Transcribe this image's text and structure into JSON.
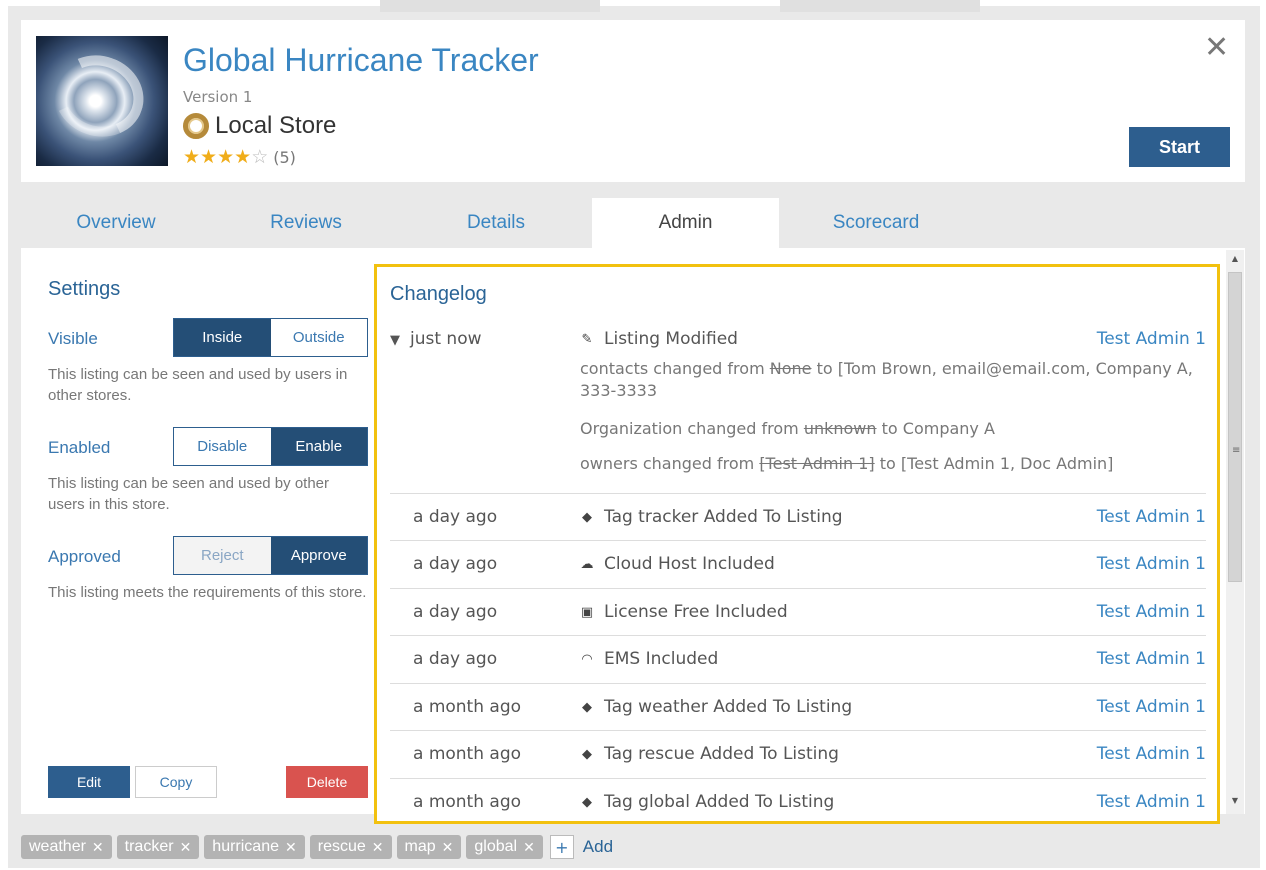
{
  "listing": {
    "title": "Global Hurricane Tracker",
    "version": "Version 1",
    "store": "Local Store",
    "rating_stars_filled": 4,
    "rating_stars_total": 5,
    "rating_count": "(5)",
    "close_glyph": "✕",
    "start_label": "Start"
  },
  "tabs": [
    {
      "label": "Overview",
      "active": false
    },
    {
      "label": "Reviews",
      "active": false
    },
    {
      "label": "Details",
      "active": false
    },
    {
      "label": "Admin",
      "active": true
    },
    {
      "label": "Scorecard",
      "active": false
    }
  ],
  "settings": {
    "title": "Settings",
    "visible": {
      "label": "Visible",
      "options": [
        "Inside",
        "Outside"
      ],
      "selected": "Inside",
      "description": "This listing can be seen and used by users in other stores."
    },
    "enabled": {
      "label": "Enabled",
      "options": [
        "Disable",
        "Enable"
      ],
      "selected": "Enable",
      "description": "This listing can be seen and used by other users in this store."
    },
    "approved": {
      "label": "Approved",
      "options": [
        "Reject",
        "Approve"
      ],
      "selected": "Approve",
      "description": "This listing meets the requirements of this store."
    },
    "buttons": {
      "edit": "Edit",
      "copy": "Copy",
      "delete": "Delete"
    }
  },
  "changelog": {
    "title": "Changelog",
    "first": {
      "when": "just now",
      "action": "Listing Modified",
      "user": "Test Admin 1",
      "details": [
        {
          "prefix": "contacts changed from",
          "old": "None",
          "mid": "to",
          "new": "[Tom Brown, email@email.com, Company A, 333-3333"
        },
        {
          "prefix": "Organization changed from",
          "old": "unknown",
          "mid": "to",
          "new": "Company A"
        },
        {
          "prefix": "owners changed from",
          "old": "[Test Admin 1]",
          "mid": "to",
          "new": "[Test Admin 1, Doc Admin]"
        }
      ]
    },
    "entries": [
      {
        "when": "a day ago",
        "icon": "tag-icon",
        "action": "Tag tracker Added To Listing",
        "user": "Test Admin 1"
      },
      {
        "when": "a day ago",
        "icon": "cloud-icon",
        "action": "Cloud Host Included",
        "user": "Test Admin 1"
      },
      {
        "when": "a day ago",
        "icon": "license-icon",
        "action": "License Free Included",
        "user": "Test Admin 1"
      },
      {
        "when": "a day ago",
        "icon": "headset-icon",
        "action": "EMS Included",
        "user": "Test Admin 1"
      },
      {
        "when": "a month ago",
        "icon": "tag-icon",
        "action": "Tag weather Added To Listing",
        "user": "Test Admin 1"
      },
      {
        "when": "a month ago",
        "icon": "tag-icon",
        "action": "Tag rescue Added To Listing",
        "user": "Test Admin 1"
      },
      {
        "when": "a month ago",
        "icon": "tag-icon",
        "action": "Tag global Added To Listing",
        "user": "Test Admin 1"
      }
    ]
  },
  "tags": [
    "weather",
    "tracker",
    "hurricane",
    "rescue",
    "map",
    "global"
  ],
  "add_tag_label": "Add",
  "colors": {
    "accent": "#3a86c2",
    "primary_button": "#2d5e8e",
    "danger": "#d9534f",
    "highlight": "#f2c10f"
  }
}
